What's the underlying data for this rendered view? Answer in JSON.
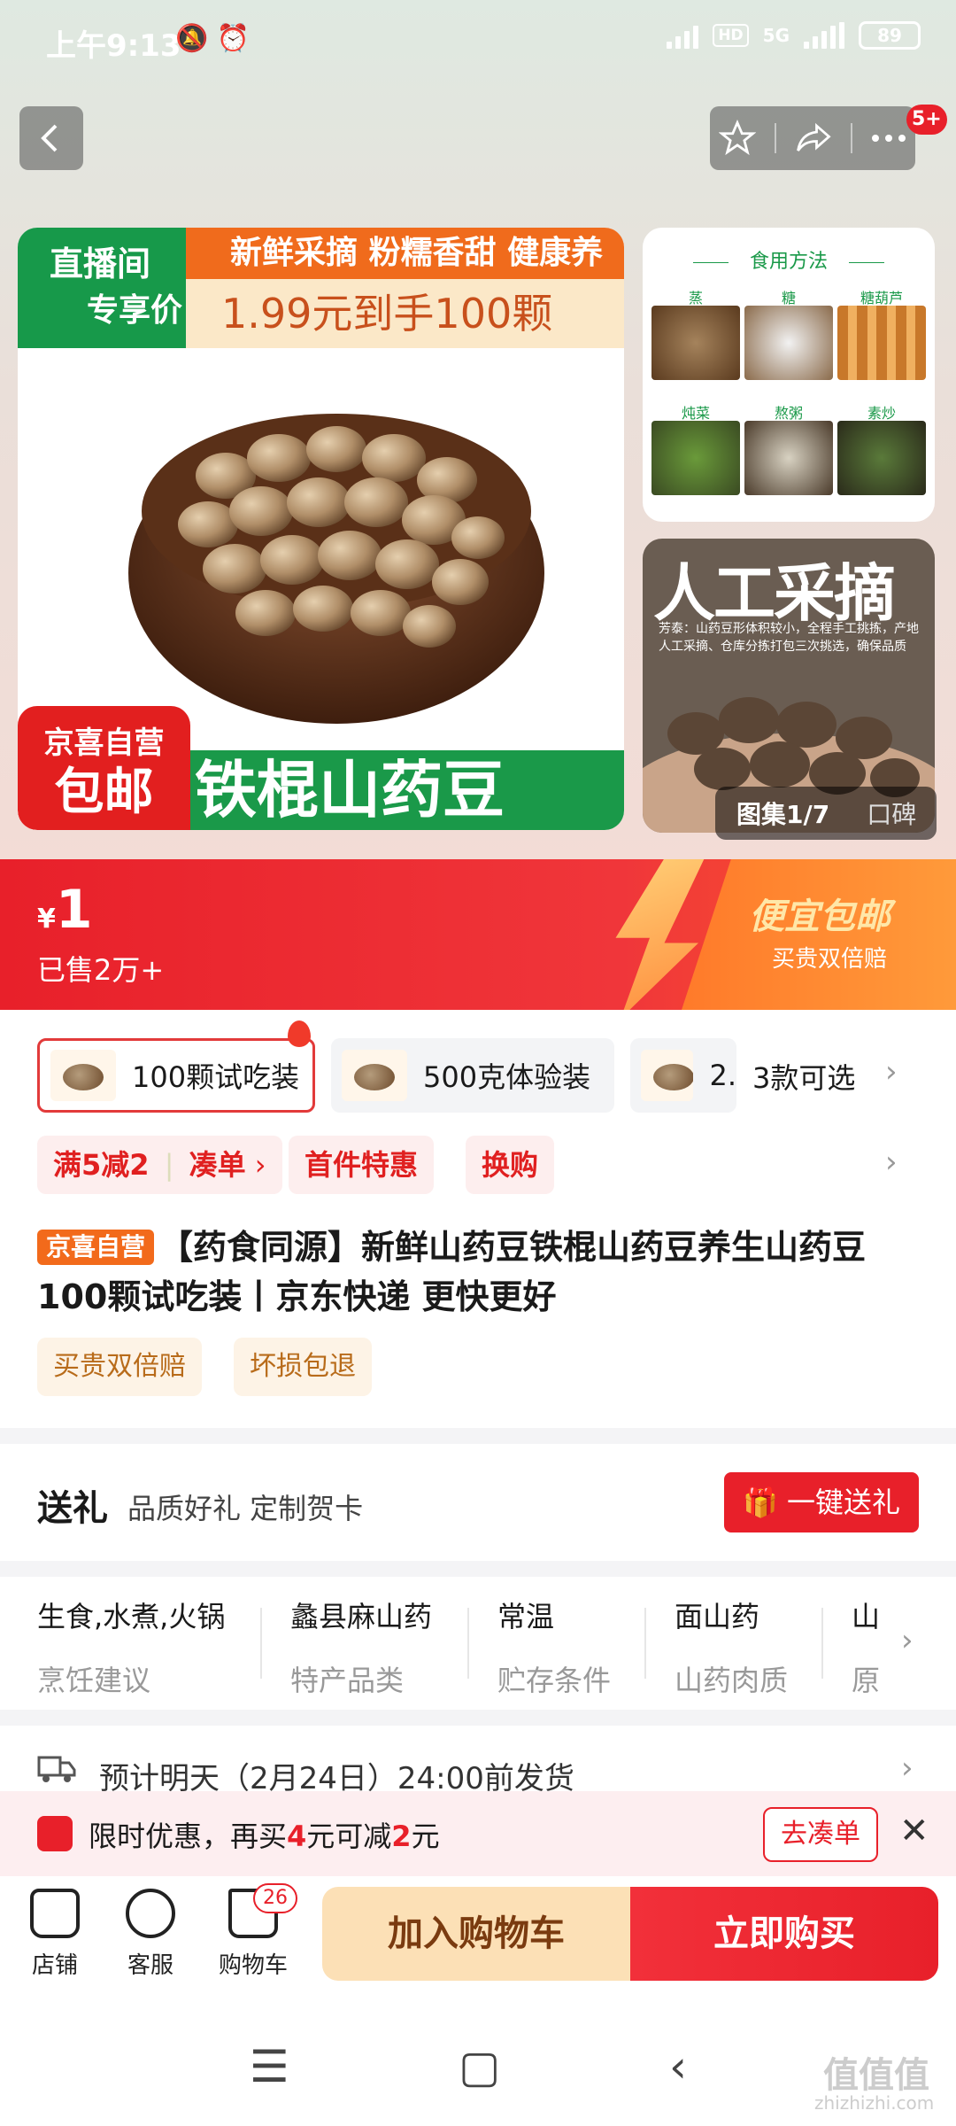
{
  "status_bar": {
    "time": "上午9:13",
    "network": "5G",
    "hd": "HD",
    "battery": "89"
  },
  "header": {
    "more_badge": "5+"
  },
  "main_image": {
    "promo_green_line1": "直播间",
    "promo_green_line2": "专享价",
    "promo_orange": "新鲜采摘 粉糯香甜 健康养生",
    "promo_cream": "1.99元到手100颗",
    "badge_line1": "京喜自营",
    "badge_line2": "包邮",
    "bottom_text": "铁棍山药豆"
  },
  "thumb_top": {
    "title": "食用方法",
    "cells": [
      "蒸",
      "糖",
      "糖葫芦",
      "炖菜",
      "熬粥",
      "素炒"
    ]
  },
  "thumb_bottom": {
    "heading": "人工采摘",
    "desc": "芳泰：山药豆形体积较小，全程手工挑拣，产地人工采摘、仓库分拣打包三次挑选，确保品质"
  },
  "gallery": {
    "tab_active": "图集1/7",
    "tab_other": "口碑"
  },
  "price_banner": {
    "currency": "¥",
    "price": "1",
    "sold": "已售2万+",
    "title": "便宜包邮",
    "subtitle": "买贵双倍赔"
  },
  "sku": {
    "options": [
      "100颗试吃装",
      "500克体验装",
      "2."
    ],
    "more": "3款可选"
  },
  "promos": [
    "满5减2",
    "凑单",
    "首件特惠",
    "换购"
  ],
  "product": {
    "tag": "京喜自营",
    "title": "【药食同源】新鲜山药豆铁棍山药豆养生山药豆 100颗试吃装丨京东快递 更快更好",
    "services": [
      "买贵双倍赔",
      "坏损包退"
    ]
  },
  "gift": {
    "title": "送礼",
    "subtitle": "品质好礼 定制贺卡",
    "button": "一键送礼"
  },
  "attributes": [
    {
      "value": "生食,水煮,火锅",
      "key": "烹饪建议"
    },
    {
      "value": "蠡县麻山药",
      "key": "特产品类"
    },
    {
      "value": "常温",
      "key": "贮存条件"
    },
    {
      "value": "面山药",
      "key": "山药肉质"
    },
    {
      "value": "山",
      "key": "原"
    }
  ],
  "shipping": {
    "text": "预计明天（2月24日）24:00前发货"
  },
  "offer": {
    "pre": "限时优惠，再买",
    "amt1": "4",
    "mid": "元可减",
    "amt2": "2",
    "post": "元",
    "button": "去凑单"
  },
  "bottom_bar": {
    "store": "店铺",
    "service": "客服",
    "cart": "购物车",
    "cart_count": "26",
    "add_cart": "加入购物车",
    "buy_now": "立即购买"
  },
  "watermark": {
    "main": "值值值",
    "sub": "zhizhizhi.com"
  },
  "colors": {
    "accent": "#e8202a",
    "green": "#1a9949",
    "orange": "#f26a1b"
  }
}
